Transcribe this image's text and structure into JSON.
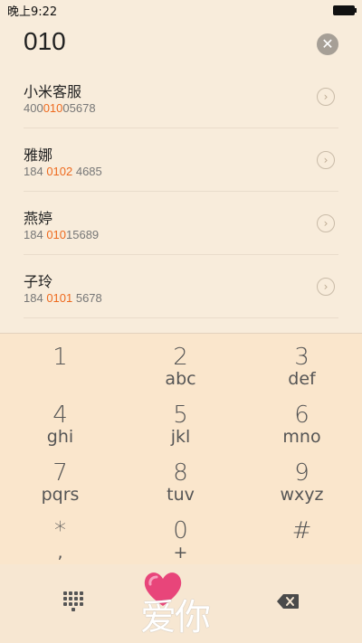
{
  "status_bar": {
    "time": "晚上9:22"
  },
  "search": {
    "typed": "010",
    "clear_symbol": "✕"
  },
  "contacts": [
    {
      "name": "小米客服",
      "phone_pre": "400",
      "phone_hl": "010",
      "phone_post": "05678"
    },
    {
      "name": "雅娜",
      "phone_pre": "184 ",
      "phone_hl": "0102",
      "phone_post": " 4685"
    },
    {
      "name": "燕婷",
      "phone_pre": "184 ",
      "phone_hl": "010",
      "phone_post": "15689"
    },
    {
      "name": "子玲",
      "phone_pre": "184 ",
      "phone_hl": "0101",
      "phone_post": " 5678"
    }
  ],
  "keypad": {
    "keys": [
      {
        "digit": "1",
        "letters": ""
      },
      {
        "digit": "2",
        "letters": "abc"
      },
      {
        "digit": "3",
        "letters": "def"
      },
      {
        "digit": "4",
        "letters": "ghi"
      },
      {
        "digit": "5",
        "letters": "jkl"
      },
      {
        "digit": "6",
        "letters": "mno"
      },
      {
        "digit": "7",
        "letters": "pqrs"
      },
      {
        "digit": "8",
        "letters": "tuv"
      },
      {
        "digit": "9",
        "letters": "wxyz"
      },
      {
        "digit": "*",
        "letters": ","
      },
      {
        "digit": "0",
        "letters": "+"
      },
      {
        "digit": "#",
        "letters": ""
      }
    ]
  },
  "bottom_bar": {
    "call_label": "爱你"
  },
  "colors": {
    "background": "#f8ecdb",
    "highlight": "#ee6a1f",
    "heart": "#e8457a"
  }
}
